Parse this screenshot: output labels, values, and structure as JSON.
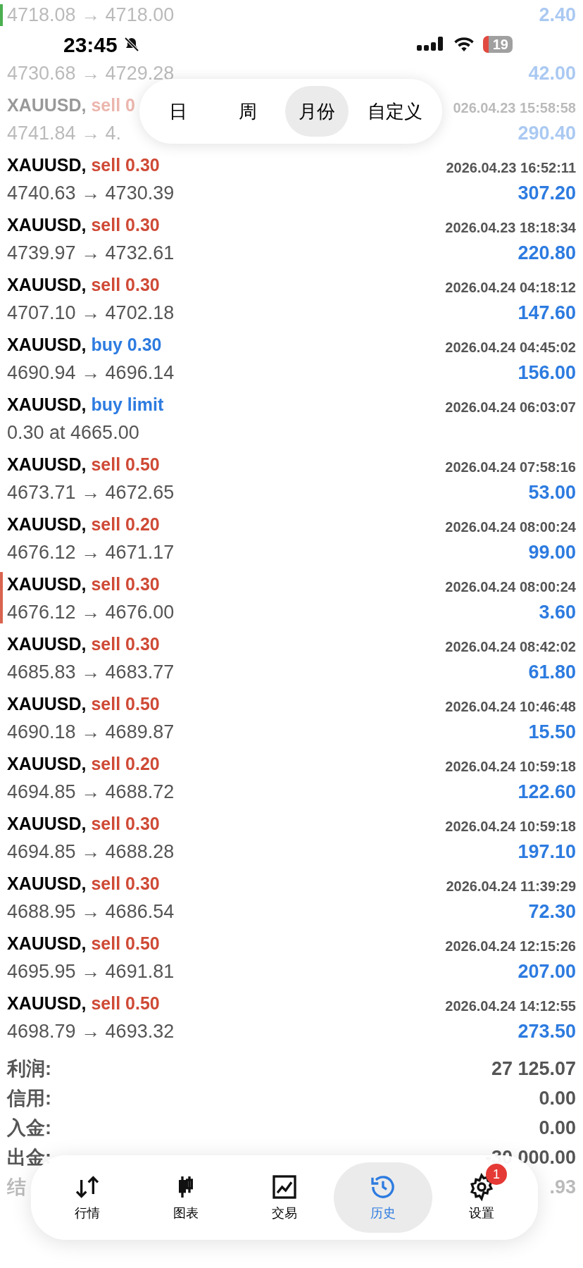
{
  "status_bar": {
    "time": "23:45",
    "battery": "19"
  },
  "period_tabs": [
    {
      "label": "日",
      "selected": false
    },
    {
      "label": "周",
      "selected": false
    },
    {
      "label": "月份",
      "selected": true
    },
    {
      "label": "自定义",
      "selected": false
    }
  ],
  "trades": [
    {
      "faded": true,
      "color": "#4caf50",
      "prices": "4718.08 → 4718.00",
      "profit": "2.40"
    },
    {
      "faded": true,
      "prices": "4730.68 → 4729.28",
      "profit": "42.00"
    },
    {
      "faded": true,
      "symbol": "XAUUSD,",
      "side": {
        "text": "sell 0",
        "kind": "sell"
      },
      "date": "026.04.23 15:58:58",
      "prices": "4741.84 → 4.",
      "profit": "290.40"
    },
    {
      "faded": false,
      "symbol": "XAUUSD,",
      "side": {
        "text": "sell 0.30",
        "kind": "sell"
      },
      "date": "2026.04.23 16:52:11",
      "prices": "4740.63 → 4730.39",
      "profit": "307.20"
    },
    {
      "faded": false,
      "symbol": "XAUUSD,",
      "side": {
        "text": "sell 0.30",
        "kind": "sell"
      },
      "date": "2026.04.23 18:18:34",
      "prices": "4739.97 → 4732.61",
      "profit": "220.80"
    },
    {
      "faded": false,
      "symbol": "XAUUSD,",
      "side": {
        "text": "sell 0.30",
        "kind": "sell"
      },
      "date": "2026.04.24 04:18:12",
      "prices": "4707.10 → 4702.18",
      "profit": "147.60"
    },
    {
      "faded": false,
      "symbol": "XAUUSD,",
      "side": {
        "text": "buy 0.30",
        "kind": "buy"
      },
      "date": "2026.04.24 04:45:02",
      "prices": "4690.94 → 4696.14",
      "profit": "156.00"
    },
    {
      "faded": false,
      "symbol": "XAUUSD,",
      "side": {
        "text": "buy limit",
        "kind": "buy"
      },
      "date": "2026.04.24 06:03:07",
      "prices": "0.30 at 4665.00"
    },
    {
      "faded": false,
      "symbol": "XAUUSD,",
      "side": {
        "text": "sell 0.50",
        "kind": "sell"
      },
      "date": "2026.04.24 07:58:16",
      "prices": "4673.71 → 4672.65",
      "profit": "53.00"
    },
    {
      "faded": false,
      "symbol": "XAUUSD,",
      "side": {
        "text": "sell 0.20",
        "kind": "sell"
      },
      "date": "2026.04.24 08:00:24",
      "prices": "4676.12 → 4671.17",
      "profit": "99.00"
    },
    {
      "faded": false,
      "color": "#d9644f",
      "symbol": "XAUUSD,",
      "side": {
        "text": "sell 0.30",
        "kind": "sell"
      },
      "date": "2026.04.24 08:00:24",
      "prices": "4676.12 → 4676.00",
      "profit": "3.60"
    },
    {
      "faded": false,
      "symbol": "XAUUSD,",
      "side": {
        "text": "sell 0.30",
        "kind": "sell"
      },
      "date": "2026.04.24 08:42:02",
      "prices": "4685.83 → 4683.77",
      "profit": "61.80"
    },
    {
      "faded": false,
      "symbol": "XAUUSD,",
      "side": {
        "text": "sell 0.50",
        "kind": "sell"
      },
      "date": "2026.04.24 10:46:48",
      "prices": "4690.18 → 4689.87",
      "profit": "15.50"
    },
    {
      "faded": false,
      "symbol": "XAUUSD,",
      "side": {
        "text": "sell 0.20",
        "kind": "sell"
      },
      "date": "2026.04.24 10:59:18",
      "prices": "4694.85 → 4688.72",
      "profit": "122.60"
    },
    {
      "faded": false,
      "symbol": "XAUUSD,",
      "side": {
        "text": "sell 0.30",
        "kind": "sell"
      },
      "date": "2026.04.24 10:59:18",
      "prices": "4694.85 → 4688.28",
      "profit": "197.10"
    },
    {
      "faded": false,
      "symbol": "XAUUSD,",
      "side": {
        "text": "sell 0.30",
        "kind": "sell"
      },
      "date": "2026.04.24 11:39:29",
      "prices": "4688.95 → 4686.54",
      "profit": "72.30"
    },
    {
      "faded": false,
      "symbol": "XAUUSD,",
      "side": {
        "text": "sell 0.50",
        "kind": "sell"
      },
      "date": "2026.04.24 12:15:26",
      "prices": "4695.95 → 4691.81",
      "profit": "207.00"
    },
    {
      "faded": false,
      "symbol": "XAUUSD,",
      "side": {
        "text": "sell 0.50",
        "kind": "sell"
      },
      "date": "2026.04.24 14:12:55",
      "prices": "4698.79 → 4693.32",
      "profit": "273.50"
    }
  ],
  "summary": [
    {
      "label": "利润:",
      "value": "27 125.07",
      "faded": false
    },
    {
      "label": "信用:",
      "value": "0.00",
      "faded": false
    },
    {
      "label": "入金:",
      "value": "0.00",
      "faded": false
    },
    {
      "label": "出金:",
      "value": "-30 000.00",
      "faded": false
    },
    {
      "label": "结",
      "value": ".93",
      "faded": true
    }
  ],
  "nav": [
    {
      "label": "行情",
      "selected": false
    },
    {
      "label": "图表",
      "selected": false
    },
    {
      "label": "交易",
      "selected": false
    },
    {
      "label": "历史",
      "selected": true
    },
    {
      "label": "设置",
      "selected": false,
      "badge": "1"
    }
  ]
}
